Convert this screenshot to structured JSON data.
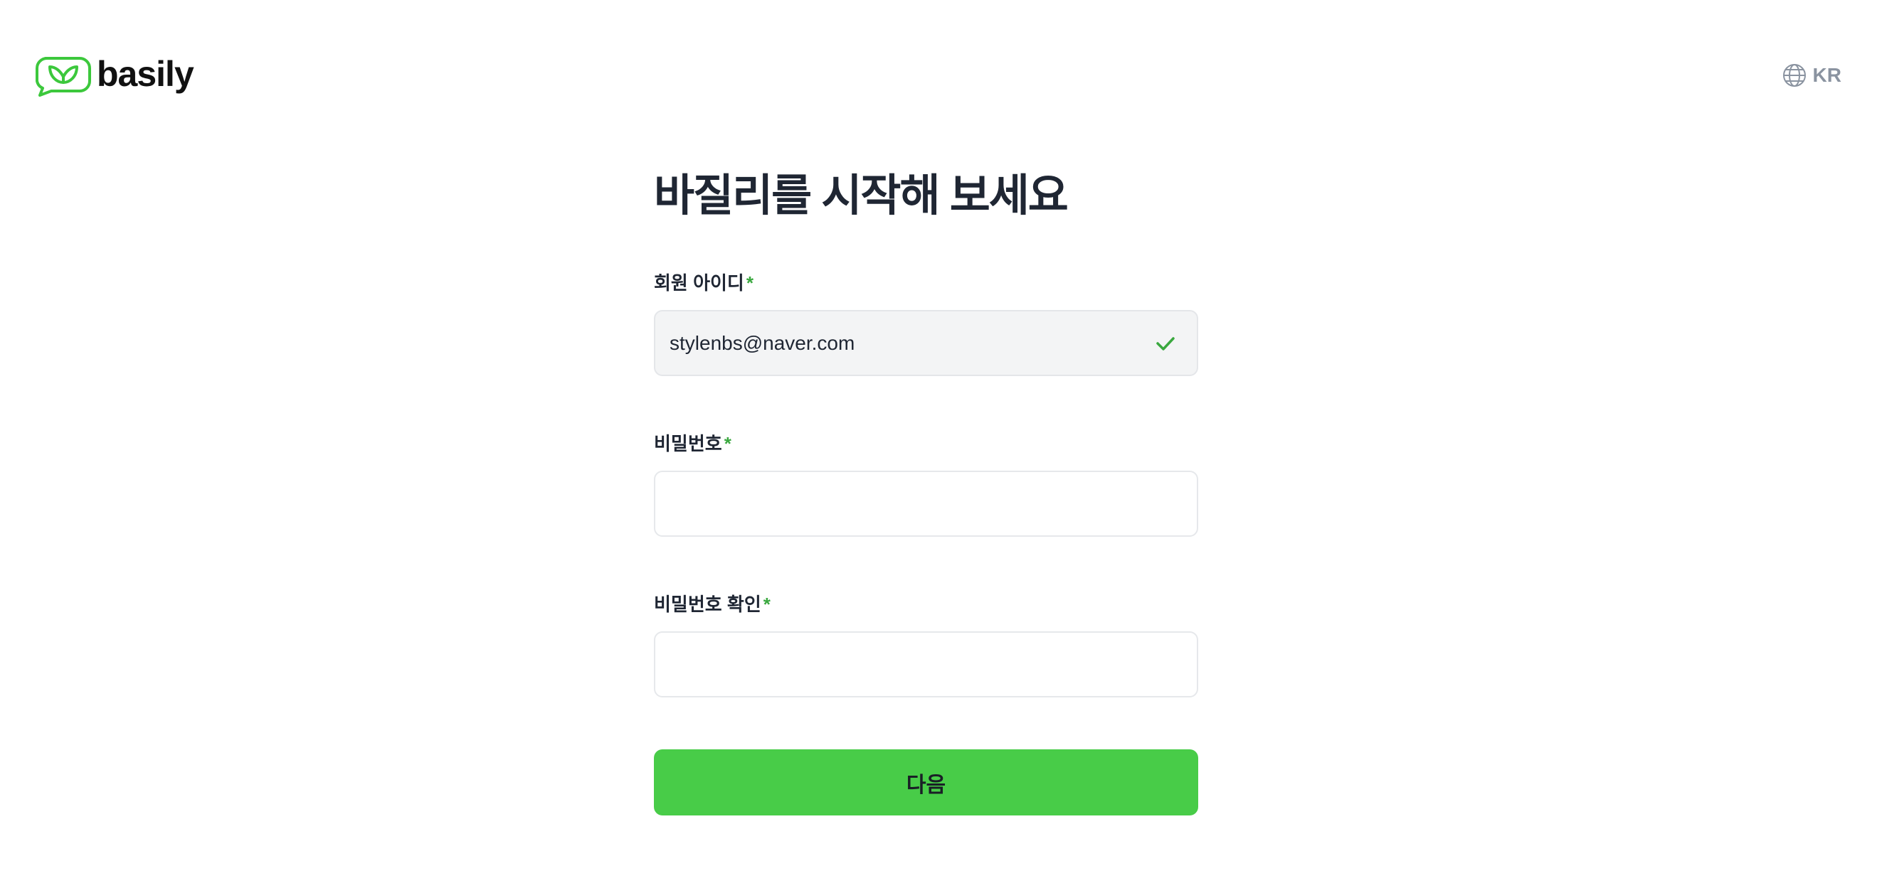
{
  "header": {
    "brand_name": "basily",
    "brand_color": "#3cc83c",
    "language_label": "KR",
    "language_icon": "globe-icon"
  },
  "form": {
    "title": "바질리를 시작해 보세요",
    "required_mark": "*",
    "fields": [
      {
        "label": "회원 아이디",
        "value": "stylenbs@naver.com",
        "placeholder": "",
        "validated": true,
        "status_icon": "check-icon"
      },
      {
        "label": "비밀번호",
        "value": "",
        "placeholder": ""
      },
      {
        "label": "비밀번호 확인",
        "value": "",
        "placeholder": ""
      }
    ],
    "submit_label": "다음"
  },
  "colors": {
    "accent": "#48cc48",
    "required": "#3aa83f",
    "text": "#1f2633",
    "muted": "#8a93a0",
    "filled_input_bg": "#f3f4f5",
    "input_border": "#e6e8eb"
  }
}
